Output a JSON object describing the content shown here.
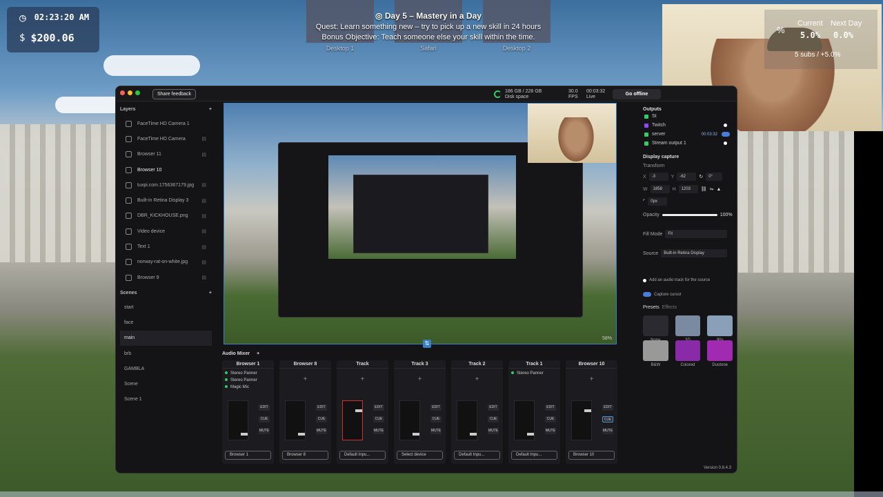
{
  "hud": {
    "time": "02:23:20 AM",
    "money": "$200.06"
  },
  "quest": {
    "title": "Day 5 – Mastery in a Day",
    "quest_line": "Quest: Learn something new – try to pick up a new skill in 24 hours",
    "bonus_line": "Bonus Objective: Teach someone else your skill within the time.",
    "desktops": [
      "Desktop 1",
      "Safari",
      "Desktop 2"
    ]
  },
  "stats": {
    "current_label": "Current",
    "next_label": "Next Day",
    "current": "5.0%",
    "next": "0.0%",
    "subs": "5 subs / +5.0%"
  },
  "app": {
    "share_feedback": "Share feedback",
    "disk": "186 GB / 228 GB",
    "disk_label": "Disk space",
    "fps": "30.0",
    "fps_label": "FPS",
    "live_time": "00:03:32",
    "live_label": "Live",
    "go_offline": "Go offline",
    "layers_title": "Layers",
    "layers": [
      "FaceTime HD Camera 1",
      "FaceTime HD Camera",
      "Browser 11",
      "Browser 10",
      "tuxpi.com.1756367179.jpg",
      "Built-in Retina Display 3",
      "DBR_KICKHOUSE.png",
      "Video device",
      "Text 1",
      "norway-rat-on-white.jpg",
      "Browser 9"
    ],
    "scenes_title": "Scenes",
    "scenes": [
      "start",
      "face",
      "main",
      "brb",
      "GAMBLA",
      "Scene",
      "Scene 1"
    ],
    "zoom": "58%",
    "outputs_title": "Outputs",
    "outputs": [
      "St",
      "Twitch",
      "server",
      "Stream output 1"
    ],
    "server_time": "00:03:32",
    "display_capture": "Display capture",
    "transform": "Transform",
    "x_label": "X",
    "x": "-3",
    "y_label": "Y",
    "y": "-62",
    "rot": "0°",
    "w_label": "W",
    "w": "1858",
    "h_label": "H",
    "h": "1203",
    "radius": "0px",
    "opacity_label": "Opacity",
    "opacity": "100%",
    "fill_mode_label": "Fill Mode",
    "fill_mode": "Fit",
    "source_label": "Source",
    "source": "Built-in Retina Display",
    "audio_track": "Add an audio track for the source",
    "capture_cursor": "Capture cursor",
    "presets_tab": "Presets",
    "effects_tab": "Effects",
    "presets": [
      "None",
      "3D",
      "90s",
      "B&W",
      "Colored",
      "Duotone"
    ],
    "mixer_title": "Audio Mixer",
    "strips": [
      {
        "name": "Browser 1",
        "fx": [
          "Stereo Panner",
          "Stereo Panner",
          "Magic Mic"
        ],
        "sel": "Browser 1"
      },
      {
        "name": "Browser 8",
        "fx": [],
        "sel": "Browser 8"
      },
      {
        "name": "Track",
        "fx": [],
        "sel": "Default Inpu..."
      },
      {
        "name": "Track 3",
        "fx": [],
        "sel": "Select device"
      },
      {
        "name": "Track 2",
        "fx": [],
        "sel": "Default Inpu..."
      },
      {
        "name": "Track 1",
        "fx": [
          "Stereo Panner"
        ],
        "sel": "Default Inpu..."
      },
      {
        "name": "Browser 10",
        "fx": [],
        "sel": "Browser 10"
      }
    ],
    "btn_edit": "EDIT",
    "btn_cue": "CUE",
    "btn_mute": "MUTE",
    "version": "Version 0.8.4.3"
  }
}
